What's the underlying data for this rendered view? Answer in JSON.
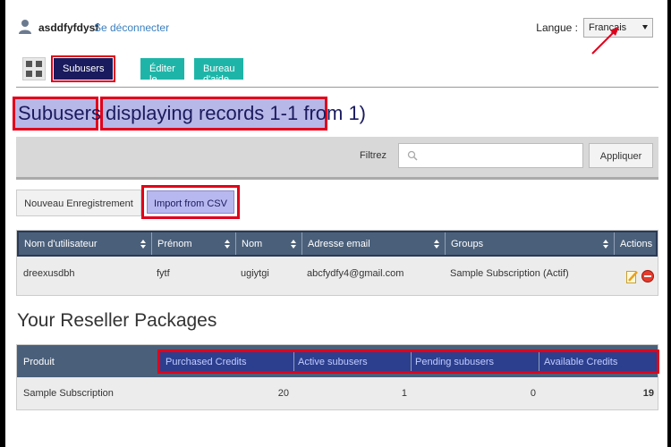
{
  "header": {
    "username": "asddfyfdysf",
    "logout_label": "Se déconnecter",
    "language_label": "Langue :",
    "language_value": "Français"
  },
  "nav": {
    "items": [
      {
        "label": "Subusers",
        "active": true
      },
      {
        "label": "Éditer le profil"
      },
      {
        "label": "Bureau d'aide"
      }
    ]
  },
  "page": {
    "title_a": "Subusers (",
    "title_b": "displaying records 1-1 from 1)"
  },
  "filter": {
    "label": "Filtrez",
    "placeholder": "",
    "apply_label": "Appliquer"
  },
  "actions": {
    "new_label": "Nouveau Enregistrement",
    "import_label": "Import from CSV"
  },
  "users_table": {
    "columns": [
      "Nom d'utilisateur",
      "Prénom",
      "Nom",
      "Adresse email",
      "Groups",
      "Actions"
    ],
    "rows": [
      {
        "username": "dreexusdbh",
        "first": "fytf",
        "last": "ugiytgi",
        "email": "abcfydfy4@gmail.com",
        "group": "Sample Subscription (Actif)"
      }
    ]
  },
  "packages": {
    "title": "Your Reseller Packages",
    "columns": [
      "Produit",
      "Purchased Credits",
      "Active subusers",
      "Pending subusers",
      "Available Credits"
    ],
    "rows": [
      {
        "product": "Sample Subscription",
        "purchased": "20",
        "active": "1",
        "pending": "0",
        "available": "19"
      }
    ]
  },
  "colors": {
    "accent_teal": "#1eb5a8",
    "active_navy": "#1a1a5e",
    "highlight_red": "#e0001b",
    "table_header": "#4a5f7a"
  }
}
